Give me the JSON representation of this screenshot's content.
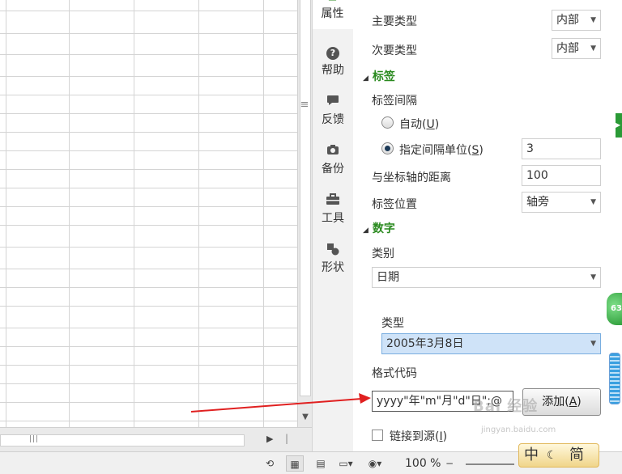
{
  "side_tabs": [
    {
      "label": "属性",
      "icon": "properties-icon"
    },
    {
      "label": "帮助",
      "icon": "help-icon"
    },
    {
      "label": "反馈",
      "icon": "feedback-icon"
    },
    {
      "label": "备份",
      "icon": "backup-icon"
    },
    {
      "label": "工具",
      "icon": "toolbox-icon"
    },
    {
      "label": "形状",
      "icon": "shapes-icon"
    }
  ],
  "panel": {
    "major_type_label": "主要类型",
    "major_type_value": "内部",
    "minor_type_label": "次要类型",
    "minor_type_value": "内部",
    "label_section": "标签",
    "label_interval_label": "标签间隔",
    "auto_label": "自动",
    "auto_hotkey": "U",
    "specified_label": "指定间隔单位",
    "specified_hotkey": "S",
    "interval_value": "3",
    "axis_distance_label": "与坐标轴的距离",
    "axis_distance_value": "100",
    "label_position_label": "标签位置",
    "label_position_value": "轴旁",
    "number_section": "数字",
    "category_label": "类别",
    "category_value": "日期",
    "type_label": "类型",
    "type_value": "2005年3月8日",
    "format_code_label": "格式代码",
    "format_code_value": "yyyy\"年\"m\"月\"d\"日\";@",
    "add_button": "添加",
    "add_hotkey": "A",
    "link_source_label": "链接到源",
    "link_source_hotkey": "I"
  },
  "status": {
    "zoom": "100 %"
  },
  "ime": {
    "chinese": "中",
    "simplified": "简"
  },
  "badge": {
    "value": "63"
  },
  "watermark": {
    "text": "Bai 经验",
    "url": "jingyan.baidu.com"
  },
  "colors": {
    "section_green": "#2a8a1f",
    "selected_type_bg": "#cfe3f8",
    "selected_type_border": "#7aaee0",
    "annotation_arrow": "#e02020"
  }
}
